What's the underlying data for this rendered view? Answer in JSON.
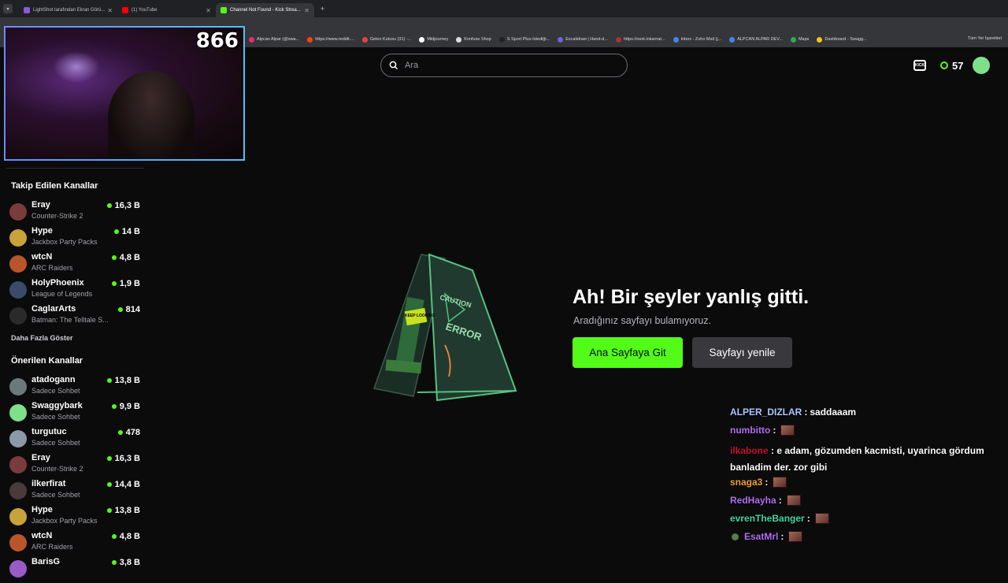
{
  "browser": {
    "tabs": [
      {
        "title": "LightShot tarafından Ekran Görü...",
        "active": false
      },
      {
        "title": "(1) YouTube",
        "active": false
      },
      {
        "title": "Channel Not Found - Kick Strea...",
        "active": true
      }
    ],
    "new_tab": "+",
    "url": "kick.com/",
    "bookmarks": [
      "Alpcan Alpar (@swa...",
      "https://www.reddit....",
      "Gelen Kutusu (31) -...",
      "Midjourney",
      "Konfuse Shop",
      "S Sport Plus-İstediği...",
      "Excalidraw | Hand-d...",
      "https://next.inkarnat...",
      "Inbox - Zoho Mail (j...",
      "ALPCAN ALPAR DEV...",
      "Maps",
      "Dashboard - Swagg..."
    ],
    "bookmarks_all": "Tüm Yer İşaretleri"
  },
  "webcam": {
    "count": "866"
  },
  "search": {
    "placeholder": "Ara"
  },
  "header": {
    "points": "57"
  },
  "sidebar": {
    "followed_title": "Takip Edilen Kanallar",
    "followed": [
      {
        "name": "Eray",
        "category": "Counter-Strike 2",
        "viewers": "16,3 B",
        "avatar_color": "#7a3b3b"
      },
      {
        "name": "Hype",
        "category": "Jackbox Party Packs",
        "viewers": "14 B",
        "avatar_color": "#c8a23a"
      },
      {
        "name": "wtcN",
        "category": "ARC Raiders",
        "viewers": "4,8 B",
        "avatar_color": "#b8562a"
      },
      {
        "name": "HolyPhoenix",
        "category": "League of Legends",
        "viewers": "1,9 B",
        "avatar_color": "#3a4a6a"
      },
      {
        "name": "CaglarArts",
        "category": "Batman: The Telltale S...",
        "viewers": "814",
        "avatar_color": "#2a2a2a"
      }
    ],
    "show_more": "Daha Fazla Göster",
    "recommended_title": "Önerilen Kanallar",
    "recommended": [
      {
        "name": "atadogann",
        "category": "Sadece Sohbet",
        "viewers": "13,8 B",
        "avatar_color": "#6a7a7a"
      },
      {
        "name": "Swaggybark",
        "category": "Sadece Sohbet",
        "viewers": "9,9 B",
        "avatar_color": "#7fe08a"
      },
      {
        "name": "turgutuc",
        "category": "Sadece Sohbet",
        "viewers": "478",
        "avatar_color": "#8a9aa8"
      },
      {
        "name": "Eray",
        "category": "Counter-Strike 2",
        "viewers": "16,3 B",
        "avatar_color": "#7a3b3b"
      },
      {
        "name": "ilkerfirat",
        "category": "Sadece Sohbet",
        "viewers": "14,4 B",
        "avatar_color": "#4a3a3a"
      },
      {
        "name": "Hype",
        "category": "Jackbox Party Packs",
        "viewers": "13,8 B",
        "avatar_color": "#c8a23a"
      },
      {
        "name": "wtcN",
        "category": "ARC Raiders",
        "viewers": "4,8 B",
        "avatar_color": "#b8562a"
      },
      {
        "name": "BarisG",
        "category": "",
        "viewers": "3,8 B",
        "avatar_color": "#9a5ac8"
      }
    ]
  },
  "error": {
    "title": "Ah! Bir şeyler yanlış gitti.",
    "subtitle": "Aradığınız sayfayı bulamıyoruz.",
    "home_button": "Ana Sayfaya Git",
    "reload_button": "Sayfayı yenile",
    "sign_top": "CAUTION",
    "sign_main": "ERROR",
    "sign_side": "KEEP LOOKING"
  },
  "chat": [
    {
      "user": "ALPER_DIZLAR",
      "color": "#a9c8ff",
      "text": "saddaaam",
      "emote": false
    },
    {
      "user": "numbitto",
      "color": "#b56cf0",
      "text": "",
      "emote": true
    },
    {
      "user": "ilkabone",
      "color": "#c8102e",
      "text": "e adam, gözumden kacmisti, uyarinca gördum banladim der. zor gibi",
      "emote": false
    },
    {
      "user": "snaga3",
      "color": "#f0a030",
      "text": "",
      "emote": true
    },
    {
      "user": "RedHayha",
      "color": "#b56cf0",
      "text": "",
      "emote": true
    },
    {
      "user": "evrenTheBanger",
      "color": "#3ed6a0",
      "text": "",
      "emote": true
    },
    {
      "user": "EsatMrl",
      "color": "#b56cf0",
      "text": "",
      "emote": true
    }
  ],
  "colors": {
    "accent": "#53fc18",
    "background": "#0b0b0c"
  }
}
